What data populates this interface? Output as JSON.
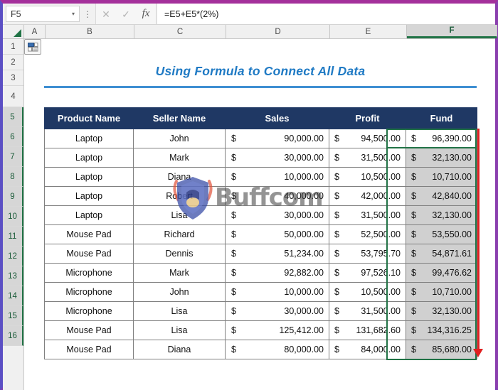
{
  "window": {
    "border_top_color": "#a4309b",
    "border_side_color": "#5b4fc4"
  },
  "formula_bar": {
    "name_box_value": "F5",
    "name_box_caret": "▾",
    "cancel_icon": "✕",
    "confirm_icon": "✓",
    "function_icon": "fx",
    "dots_icon": "⋮",
    "formula_value": "=E5+E5*(2%)",
    "formula_placeholder": ""
  },
  "grid": {
    "column_headers": [
      "A",
      "B",
      "C",
      "D",
      "E",
      "F"
    ],
    "selected_column": "F",
    "row_headers": [
      "1",
      "2",
      "3",
      "4",
      "5",
      "6",
      "7",
      "8",
      "9",
      "10",
      "11",
      "12",
      "13",
      "14",
      "15",
      "16"
    ],
    "selected_rows": [
      "5",
      "6",
      "7",
      "8",
      "9",
      "10",
      "11",
      "12",
      "13",
      "14",
      "15",
      "16"
    ],
    "select_all_icon": "select-all-triangle"
  },
  "sheet": {
    "title": "Using Formula to Connect All Data",
    "title_color": "#1f7ac4",
    "rule_color": "#3f8fd2",
    "header_fill": "#1f3864",
    "selection_color": "#217346",
    "annotation_color": "#e02020"
  },
  "table": {
    "columns": [
      "Product Name",
      "Seller Name",
      "Sales",
      "Profit",
      "Fund"
    ],
    "currency_symbol": "$",
    "rows": [
      {
        "row": "5",
        "product": "Laptop",
        "seller": "John",
        "sales": "90,000.00",
        "profit": "94,500.00",
        "fund": "96,390.00",
        "fund_state": "active"
      },
      {
        "row": "6",
        "product": "Laptop",
        "seller": "Mark",
        "sales": "30,000.00",
        "profit": "31,500.00",
        "fund": "32,130.00",
        "fund_state": "selected"
      },
      {
        "row": "7",
        "product": "Laptop",
        "seller": "Diana",
        "sales": "10,000.00",
        "profit": "10,500.00",
        "fund": "10,710.00",
        "fund_state": "selected"
      },
      {
        "row": "8",
        "product": "Laptop",
        "seller": "Robert",
        "sales": "40,000.00",
        "profit": "42,000.00",
        "fund": "42,840.00",
        "fund_state": "selected"
      },
      {
        "row": "9",
        "product": "Laptop",
        "seller": "Lisa",
        "sales": "30,000.00",
        "profit": "31,500.00",
        "fund": "32,130.00",
        "fund_state": "selected"
      },
      {
        "row": "10",
        "product": "Mouse Pad",
        "seller": "Richard",
        "sales": "50,000.00",
        "profit": "52,500.00",
        "fund": "53,550.00",
        "fund_state": "selected"
      },
      {
        "row": "11",
        "product": "Mouse Pad",
        "seller": "Dennis",
        "sales": "51,234.00",
        "profit": "53,795.70",
        "fund": "54,871.61",
        "fund_state": "selected"
      },
      {
        "row": "12",
        "product": "Microphone",
        "seller": "Mark",
        "sales": "92,882.00",
        "profit": "97,526.10",
        "fund": "99,476.62",
        "fund_state": "selected"
      },
      {
        "row": "13",
        "product": "Microphone",
        "seller": "John",
        "sales": "10,000.00",
        "profit": "10,500.00",
        "fund": "10,710.00",
        "fund_state": "selected"
      },
      {
        "row": "14",
        "product": "Microphone",
        "seller": "Lisa",
        "sales": "30,000.00",
        "profit": "31,500.00",
        "fund": "32,130.00",
        "fund_state": "selected"
      },
      {
        "row": "15",
        "product": "Mouse Pad",
        "seller": "Lisa",
        "sales": "125,412.00",
        "profit": "131,682.60",
        "fund": "134,316.25",
        "fund_state": "selected"
      },
      {
        "row": "16",
        "product": "Mouse Pad",
        "seller": "Diana",
        "sales": "80,000.00",
        "profit": "84,000.00",
        "fund": "85,680.00",
        "fund_state": "selected"
      }
    ]
  },
  "autofill": {
    "label": "autofill-options",
    "icon": "autofill-options-icon"
  },
  "watermark": {
    "text": "Buffcom",
    "logo_icon": "buffcom-shield-logo"
  }
}
